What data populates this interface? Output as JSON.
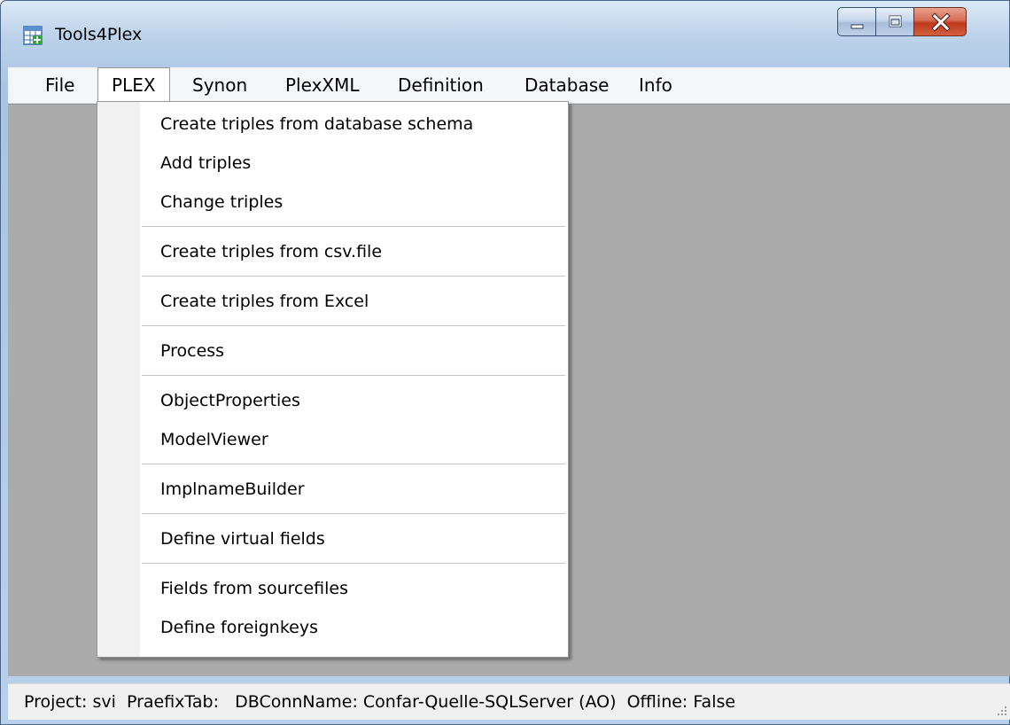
{
  "window": {
    "title": "Tools4Plex"
  },
  "menubar": {
    "items": [
      {
        "label": "File"
      },
      {
        "label": "PLEX"
      },
      {
        "label": "Synon"
      },
      {
        "label": "PlexXML"
      },
      {
        "label": "Definition"
      },
      {
        "label": "Database"
      },
      {
        "label": "Info"
      }
    ],
    "open_menu": "PLEX"
  },
  "plex_menu": {
    "items": [
      {
        "label": "Create triples from database schema"
      },
      {
        "label": "Add triples"
      },
      {
        "label": "Change triples"
      },
      {
        "label": "Create triples from csv.file"
      },
      {
        "label": "Create triples from Excel"
      },
      {
        "label": "Process"
      },
      {
        "label": "ObjectProperties"
      },
      {
        "label": "ModelViewer"
      },
      {
        "label": "ImplnameBuilder"
      },
      {
        "label": "Define virtual fields"
      },
      {
        "label": "Fields from sourcefiles"
      },
      {
        "label": "Define foreignkeys"
      }
    ]
  },
  "statusbar": {
    "text": "Project: svi  PraefixTab:   DBConnName: Confar-Quelle-SQLServer (AO)  Offline: False"
  },
  "icons": {
    "app": "grid-table-icon",
    "minimize": "minimize-icon",
    "maximize": "maximize-icon",
    "close": "close-icon",
    "grip": "size-grip-icon"
  },
  "colors": {
    "client_background": "#ababab",
    "close_button": "#c7442a",
    "title_bar": "#b9d0ea"
  }
}
